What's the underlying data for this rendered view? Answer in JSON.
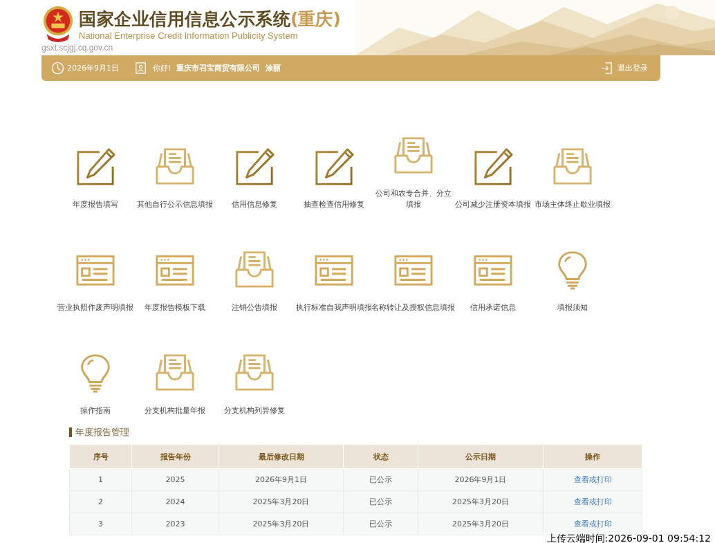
{
  "header": {
    "title": "国家企业信用信息公示系统",
    "region": "(重庆)",
    "subtitle": "National Enterprise Credit Information Publicity System",
    "url": "gsxt.scjgj.cq.gov.cn"
  },
  "user_bar": {
    "date": "2026年9月1日",
    "greeting": "你好!",
    "company": "重庆市召宝商贸有限公司",
    "user": "涂丽",
    "logout": "退出登录"
  },
  "services": [
    {
      "label": "年度报告填写",
      "kind": "pencil"
    },
    {
      "label": "其他自行公示信息填报",
      "kind": "tray"
    },
    {
      "label": "信用信息修复",
      "kind": "pencil"
    },
    {
      "label": "抽查检查信用修复",
      "kind": "pencil"
    },
    {
      "label": "公司和农专合并、分立填报",
      "kind": "tray",
      "wrap": true
    },
    {
      "label": "公司减少注册资本填报",
      "kind": "pencil"
    },
    {
      "label": "市场主体终止歇业填报",
      "kind": "tray"
    },
    {
      "label": "营业执照作废声明填报",
      "kind": "form"
    },
    {
      "label": "年度报告模板下载",
      "kind": "form"
    },
    {
      "label": "注销公告填报",
      "kind": "tray"
    },
    {
      "label": "执行标准自我声明填报",
      "kind": "form"
    },
    {
      "label": "名称转让及授权信息填报",
      "kind": "form"
    },
    {
      "label": "信用承诺信息",
      "kind": "form"
    },
    {
      "label": "填报须知",
      "kind": "bulb"
    },
    {
      "label": "操作指南",
      "kind": "bulb"
    },
    {
      "label": "分支机构批量年报",
      "kind": "tray"
    },
    {
      "label": "分支机构列异修复",
      "kind": "tray"
    }
  ],
  "annual_reports": {
    "title": "年度报告管理",
    "columns": [
      "序号",
      "报告年份",
      "最后修改日期",
      "状态",
      "公示日期",
      "操作"
    ],
    "rows": [
      [
        "1",
        "2025",
        "2026年9月1日",
        "已公示",
        "2026年9月1日",
        "查看或打印"
      ],
      [
        "2",
        "2024",
        "2025年3月20日",
        "已公示",
        "2025年3月20日",
        "查看或打印"
      ],
      [
        "3",
        "2023",
        "2025年3月20日",
        "已公示",
        "2025年3月20日",
        "查看或打印"
      ]
    ]
  },
  "upload_stamp": "上传云端时间:2026-09-01 09:54:12"
}
